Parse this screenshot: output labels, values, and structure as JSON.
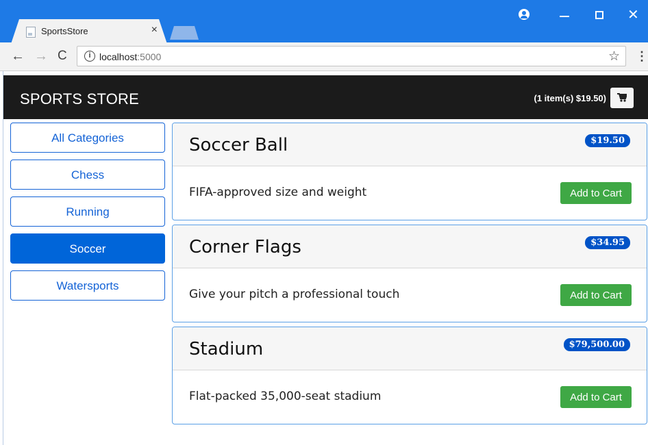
{
  "browser": {
    "tab_title": "SportsStore",
    "tab_close": "×",
    "url_host": "localhost",
    "url_port": ":5000",
    "icons": [
      "back-arrow-icon",
      "forward-arrow-icon",
      "reload-icon",
      "info-icon",
      "star-icon",
      "kebab-menu-icon",
      "account-icon"
    ]
  },
  "navbar": {
    "brand": "SPORTS STORE",
    "cart_summary": "(1 item(s) $19.50)"
  },
  "categories": [
    {
      "label": "All Categories",
      "active": false
    },
    {
      "label": "Chess",
      "active": false
    },
    {
      "label": "Running",
      "active": false
    },
    {
      "label": "Soccer",
      "active": true
    },
    {
      "label": "Watersports",
      "active": false
    }
  ],
  "products": [
    {
      "name": "Soccer Ball",
      "price": "$19.50",
      "description": "FIFA-approved size and weight",
      "button": "Add to Cart"
    },
    {
      "name": "Corner Flags",
      "price": "$34.95",
      "description": "Give your pitch a professional touch",
      "button": "Add to Cart"
    },
    {
      "name": "Stadium",
      "price": "$79,500.00",
      "description": "Flat-packed 35,000-seat stadium",
      "button": "Add to Cart"
    }
  ],
  "colors": {
    "browser_blue": "#1e7ae6",
    "navbar": "#1b1b1b",
    "primary": "#0065d9",
    "success": "#3fa845",
    "badge": "#0053c7"
  }
}
